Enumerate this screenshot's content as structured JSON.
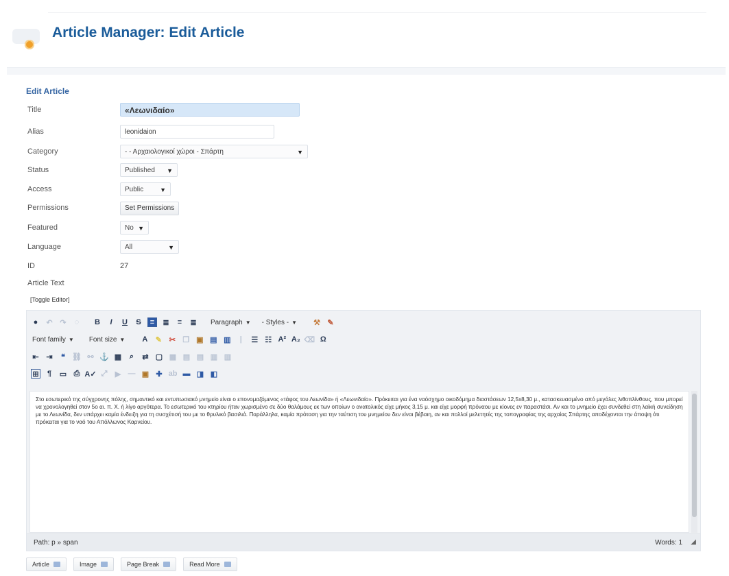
{
  "header": {
    "title": "Article Manager: Edit Article",
    "logo_icon": "joomla-logo-icon"
  },
  "form": {
    "section_title": "Edit Article",
    "title": {
      "label": "Title",
      "value": "«Λεωνιδαίο»"
    },
    "alias": {
      "label": "Alias",
      "value": "leonidaion"
    },
    "category": {
      "label": "Category",
      "value": "- - Αρχαιολογικοί χώροι - Σπάρτη"
    },
    "status": {
      "label": "Status",
      "value": "Published"
    },
    "access": {
      "label": "Access",
      "value": "Public"
    },
    "permissions": {
      "label": "Permissions",
      "button": "Set Permissions"
    },
    "featured": {
      "label": "Featured",
      "value": "No"
    },
    "language": {
      "label": "Language",
      "value": "All"
    },
    "id": {
      "label": "ID",
      "value": "27"
    },
    "article_text": {
      "label": "Article Text"
    }
  },
  "editor": {
    "toggle": "[Toggle Editor]",
    "format_dropdown": "Paragraph",
    "styles_dropdown": "- Styles -",
    "font_family": "Font family",
    "font_size": "Font size",
    "content": "Στο εσωτερικό της σύγχρονης πόλης, σημαντικό και εντυπωσιακό μνημείο είναι ο επονομαζόμενος «τάφος του Λεωνίδα» ή «Λεωνιδαίο». Πρόκειται για ένα ναόσχημο οικοδόμημα διαστάσεων 12,5x8,30 μ., κατασκευασμένο από μεγάλες λιθοπλίνθους, που μπορεί να χρονολογηθεί στον 5ο αι. π. Χ. ή λίγο αργότερα. Το εσωτερικό του κτηρίου ήταν χωρισμένο σε δύο θαλάμους εκ των οποίων ο ανατολικός είχε μήκος 3,15 μ. και είχε μορφή πρόναου με κίονες εν παραστάσι. Αν και το μνημείο έχει συνδεθεί στη λαϊκή συνείδηση με το Λεωνίδα, δεν υπάρχει καμία ένδειξη για τη συσχέτισή του με το θρυλικό βασιλιά. Παράλληλα, καμία πρόταση για την ταύτιση του μνημείου δεν είναι βέβαιη, αν και πολλοί μελετητές της τοπογραφίας της αρχαίας Σπάρτης αποδέχονται την άποψη ότι πρόκειται για το ναό του Απόλλωνος Καρνείου.",
    "path_label": "Path:",
    "path_value": "p » span",
    "words_label": "Words:",
    "words_value": "1"
  },
  "extra_buttons": [
    "Article",
    "Image",
    "Page Break",
    "Read More"
  ]
}
